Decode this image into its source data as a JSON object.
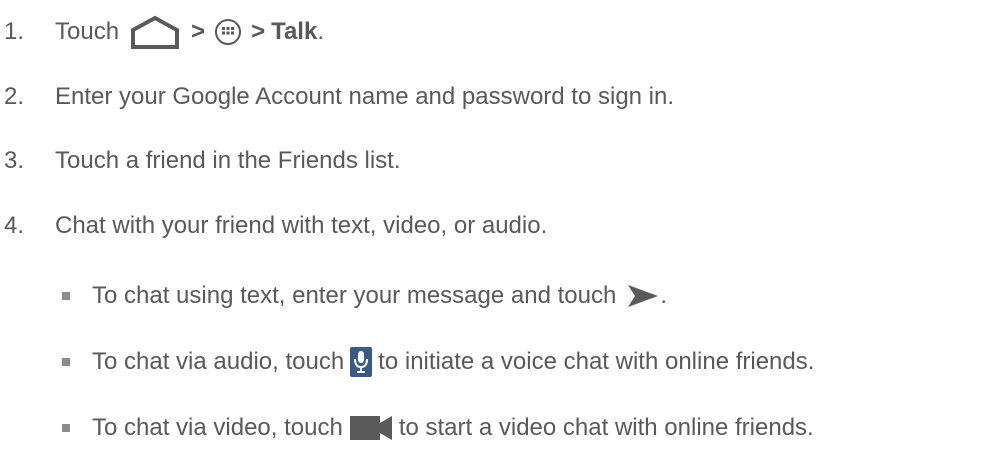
{
  "steps": [
    {
      "number": "1.",
      "parts": {
        "t1": "Touch",
        "sep1": ">",
        "sep2": ">",
        "bold": "Talk",
        "end": "."
      },
      "icons": [
        "home-icon",
        "apps-icon"
      ]
    },
    {
      "number": "2.",
      "text": "Enter your Google Account name and password to sign in."
    },
    {
      "number": "3.",
      "text": "Touch a friend in the Friends list."
    },
    {
      "number": "4.",
      "text": "Chat with your friend with text, video, or audio."
    }
  ],
  "substeps": [
    {
      "before": "To chat using text, enter your message and touch",
      "after": ".",
      "icon": "send-icon"
    },
    {
      "before": "To chat via audio, touch",
      "after": "to initiate a voice chat with online friends.",
      "icon": "microphone-icon"
    },
    {
      "before": "To chat via video, touch",
      "after": "to start a video chat with online friends.",
      "icon": "video-camera-icon"
    }
  ],
  "colors": {
    "text": "#595959",
    "icon": "#5a5a5a",
    "mic": "#3a5a86"
  }
}
